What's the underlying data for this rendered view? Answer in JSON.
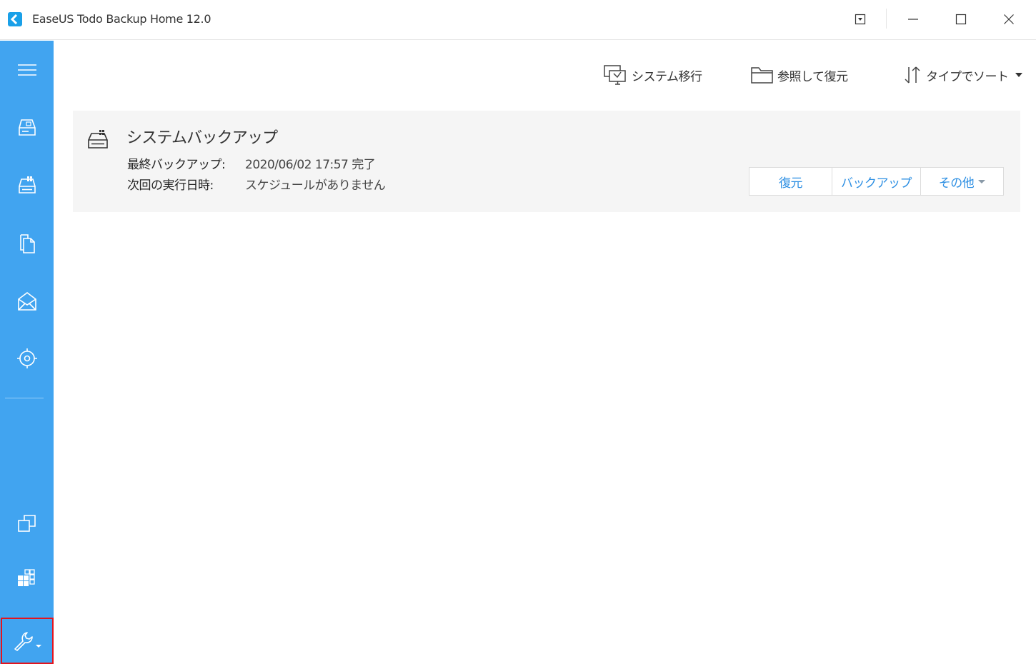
{
  "window": {
    "title": "EaseUS Todo Backup Home 12.0",
    "icons": [
      "easeus-logo-icon",
      "dropdown-menu-icon",
      "minimize-icon",
      "maximize-icon",
      "close-icon"
    ]
  },
  "sidebar": {
    "items": [
      {
        "name": "menu",
        "icon": "hamburger-menu-icon"
      },
      {
        "name": "disk-backup",
        "icon": "disk-backup-icon"
      },
      {
        "name": "system-backup",
        "icon": "system-backup-icon"
      },
      {
        "name": "file-backup",
        "icon": "file-backup-icon"
      },
      {
        "name": "mail-backup",
        "icon": "mail-backup-icon"
      },
      {
        "name": "smart-backup",
        "icon": "smart-backup-icon"
      },
      {
        "name": "clone",
        "icon": "clone-icon"
      },
      {
        "name": "system-transfer",
        "icon": "system-transfer-icon"
      },
      {
        "name": "tools",
        "icon": "wrench-icon"
      }
    ],
    "accent_color": "#41a4f0",
    "highlight_color": "#e3141e"
  },
  "toolbar": {
    "migrate_label": "システム移行",
    "browse_label": "参照して復元",
    "sort_label": "タイプでソート"
  },
  "backup_card": {
    "title": "システムバックアップ",
    "last_backup_label": "最終バックアップ:",
    "last_backup_value": "2020/06/02 17:57 完了",
    "next_run_label": "次回の実行日時:",
    "next_run_value": "スケジュールがありません",
    "actions": {
      "restore": "復元",
      "backup": "バックアップ",
      "more": "その他"
    },
    "link_color": "#2d8fe3"
  }
}
